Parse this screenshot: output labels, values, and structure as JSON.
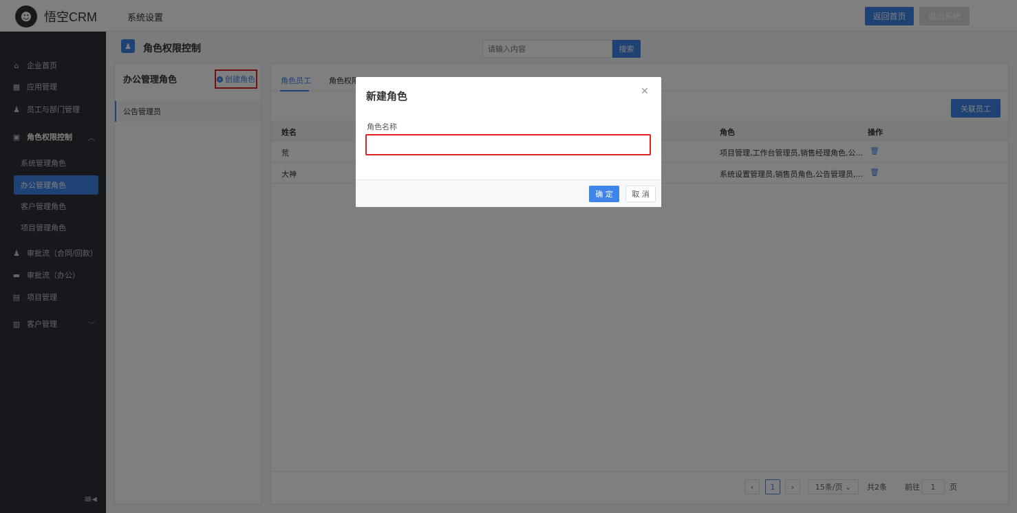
{
  "app": {
    "name": "悟空CRM",
    "page": "系统设置"
  },
  "header": {
    "home_label": "返回首页",
    "exit_label": "退出系统"
  },
  "sidebar": {
    "items": [
      {
        "label": "企业首页",
        "icon": "home-icon"
      },
      {
        "label": "应用管理",
        "icon": "apps-icon"
      },
      {
        "label": "员工与部门管理",
        "icon": "users-icon"
      },
      {
        "label": "角色权限控制",
        "icon": "role-icon"
      },
      {
        "label": "审批流（合同/回款）",
        "icon": "person-icon"
      },
      {
        "label": "审批流（办公）",
        "icon": "monitor-icon"
      },
      {
        "label": "项目管理",
        "icon": "project-icon"
      },
      {
        "label": "客户管理",
        "icon": "building-icon"
      }
    ],
    "subitems": [
      "系统管理角色",
      "办公管理角色",
      "客户管理角色",
      "项目管理角色"
    ],
    "active_sub": "办公管理角色"
  },
  "page_header": {
    "title": "角色权限控制"
  },
  "search": {
    "placeholder": "请输入内容",
    "button": "搜索"
  },
  "role_panel": {
    "title": "办公管理角色",
    "create_label": "创建角色",
    "roles": [
      "公告管理员"
    ]
  },
  "tabs": [
    "角色员工",
    "角色权限"
  ],
  "link_button": "关联员工",
  "table": {
    "headers": {
      "name": "姓名",
      "role": "角色",
      "action": "操作"
    },
    "rows": [
      {
        "name": "荒",
        "role": "项目管理,工作台管理员,销售经理角色,公..."
      },
      {
        "name": "大神",
        "role": "系统设置管理员,销售员角色,公告管理员,..."
      }
    ]
  },
  "pager": {
    "current": "1",
    "page_size": "15条/页",
    "total": "共2条",
    "goto": "前往",
    "goto_value": "1",
    "page_unit": "页"
  },
  "modal": {
    "title": "新建角色",
    "field_label": "角色名称",
    "field_value": "",
    "ok": "确 定",
    "cancel": "取 消"
  },
  "colors": {
    "primary": "#3e84e9",
    "sidebar": "#2d3037",
    "highlight": "#e02020"
  }
}
